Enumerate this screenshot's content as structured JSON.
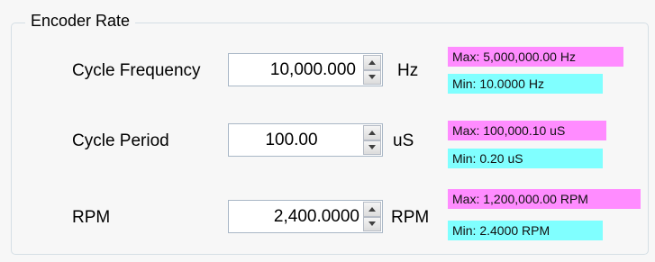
{
  "group": {
    "title": "Encoder Rate"
  },
  "rows": [
    {
      "label": "Cycle Frequency",
      "value": "10,000.000",
      "unit": "Hz",
      "max": "Max: 5,000,000.00 Hz",
      "min": "Min: 10.0000 Hz"
    },
    {
      "label": "Cycle Period",
      "value": "100.00",
      "unit": "uS",
      "max": "Max: 100,000.10 uS",
      "min": "Min: 0.20 uS"
    },
    {
      "label": "RPM",
      "value": "2,400.0000",
      "unit": "RPM",
      "max": "Max: 1,200,000.00 RPM",
      "min": "Min: 2.4000 RPM"
    }
  ],
  "colors": {
    "max_badge": "#ff8cff",
    "min_badge": "#80ffff"
  },
  "icons": {
    "spin_up": "up-arrow-icon",
    "spin_down": "down-arrow-icon"
  }
}
